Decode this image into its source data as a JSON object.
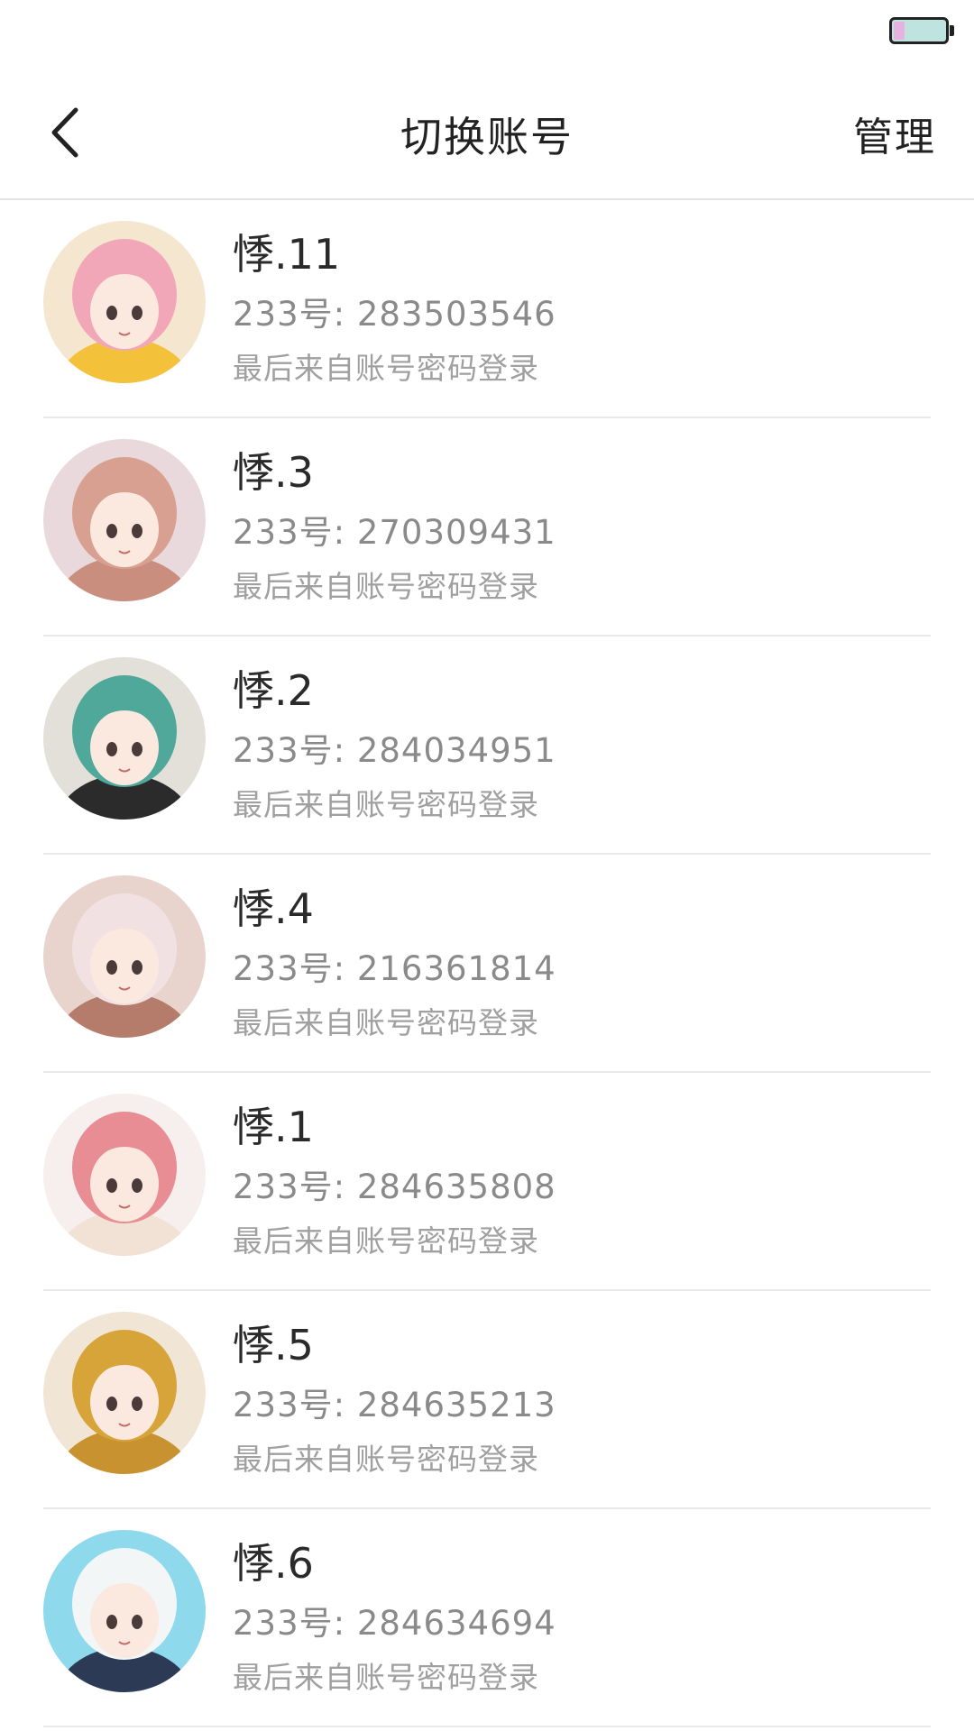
{
  "status_bar": {
    "battery_level": 0.22,
    "battery_color": "#bfe3df",
    "battery_accent": "#e6b3e0"
  },
  "header": {
    "back_icon": "chevron-left-icon",
    "title": "切换账号",
    "manage_label": "管理"
  },
  "accounts": [
    {
      "nickname": "悸.11",
      "id_text": "233号: 283503546",
      "last_login": "最后来自账号密码登录",
      "avatar_palette": [
        "#f5e6cf",
        "#f2a7b8",
        "#f3c23a"
      ]
    },
    {
      "nickname": "悸.3",
      "id_text": "233号: 270309431",
      "last_login": "最后来自账号密码登录",
      "avatar_palette": [
        "#e9d9dc",
        "#d7a091",
        "#c98e7d"
      ]
    },
    {
      "nickname": "悸.2",
      "id_text": "233号: 284034951",
      "last_login": "最后来自账号密码登录",
      "avatar_palette": [
        "#e3e0da",
        "#4fa89a",
        "#2b2b2b"
      ]
    },
    {
      "nickname": "悸.4",
      "id_text": "233号: 216361814",
      "last_login": "最后来自账号密码登录",
      "avatar_palette": [
        "#e8d4cc",
        "#f1e1e3",
        "#b57c6b"
      ]
    },
    {
      "nickname": "悸.1",
      "id_text": "233号: 284635808",
      "last_login": "最后来自账号密码登录",
      "avatar_palette": [
        "#f7efee",
        "#e78d93",
        "#f2e2d6"
      ]
    },
    {
      "nickname": "悸.5",
      "id_text": "233号: 284635213",
      "last_login": "最后来自账号密码登录",
      "avatar_palette": [
        "#f1e6d6",
        "#d7a43a",
        "#c99230"
      ]
    },
    {
      "nickname": "悸.6",
      "id_text": "233号: 284634694",
      "last_login": "最后来自账号密码登录",
      "avatar_palette": [
        "#8fd9ec",
        "#f3f6f7",
        "#2d3a55"
      ]
    }
  ]
}
